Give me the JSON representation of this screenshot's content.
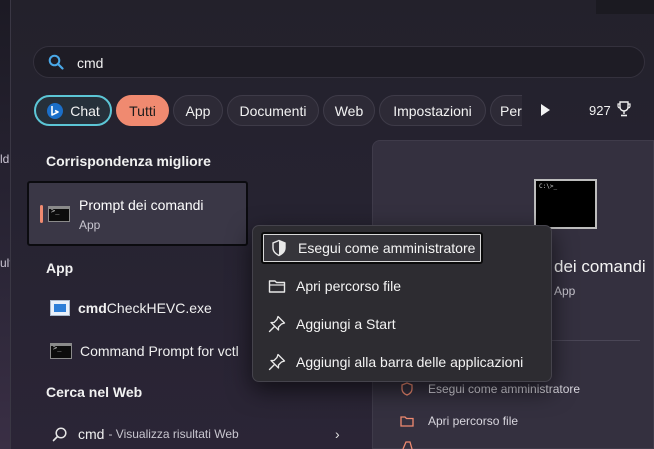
{
  "search": {
    "query": "cmd"
  },
  "filters": {
    "chips": [
      {
        "label": "Chat",
        "state": "chat"
      },
      {
        "label": "Tutti",
        "state": "active"
      },
      {
        "label": "App",
        "state": "default"
      },
      {
        "label": "Documenti",
        "state": "default"
      },
      {
        "label": "Web",
        "state": "default"
      },
      {
        "label": "Impostazioni",
        "state": "default"
      },
      {
        "label": "Per",
        "state": "truncated"
      }
    ],
    "points": "927",
    "accent_color": "#f08a70",
    "chat_outline_color": "#5cc6d6"
  },
  "desktop": {
    "edge_texts": [
      "ld",
      "ult"
    ]
  },
  "best_match": {
    "section_title": "Corrispondenza migliore",
    "title": "Prompt dei comandi",
    "subtitle": "App",
    "icon": "command-prompt-icon"
  },
  "apps": {
    "section_title": "App",
    "items": [
      {
        "bold": "cmd",
        "rest": "CheckHEVC.exe",
        "icon": "exe-icon"
      },
      {
        "bold": "",
        "rest": "Command Prompt for vctl",
        "icon": "command-prompt-icon"
      }
    ]
  },
  "web": {
    "section_title": "Cerca nel Web",
    "query": "cmd",
    "description": "- Visualizza risultati Web"
  },
  "preview": {
    "title": "dei comandi",
    "subtitle": "App",
    "actions": [
      {
        "label": "Esegui come amministratore",
        "icon": "shield-icon"
      },
      {
        "label": "Apri percorso file",
        "icon": "folder-icon"
      }
    ]
  },
  "context_menu": {
    "items": [
      {
        "label": "Esegui come amministratore",
        "icon": "shield-icon",
        "focused": true
      },
      {
        "label": "Apri percorso file",
        "icon": "folder-icon",
        "focused": false
      },
      {
        "label": "Aggiungi a Start",
        "icon": "pin-icon",
        "focused": false
      },
      {
        "label": "Aggiungi alla barra delle applicazioni",
        "icon": "pin-icon",
        "focused": false
      }
    ]
  }
}
